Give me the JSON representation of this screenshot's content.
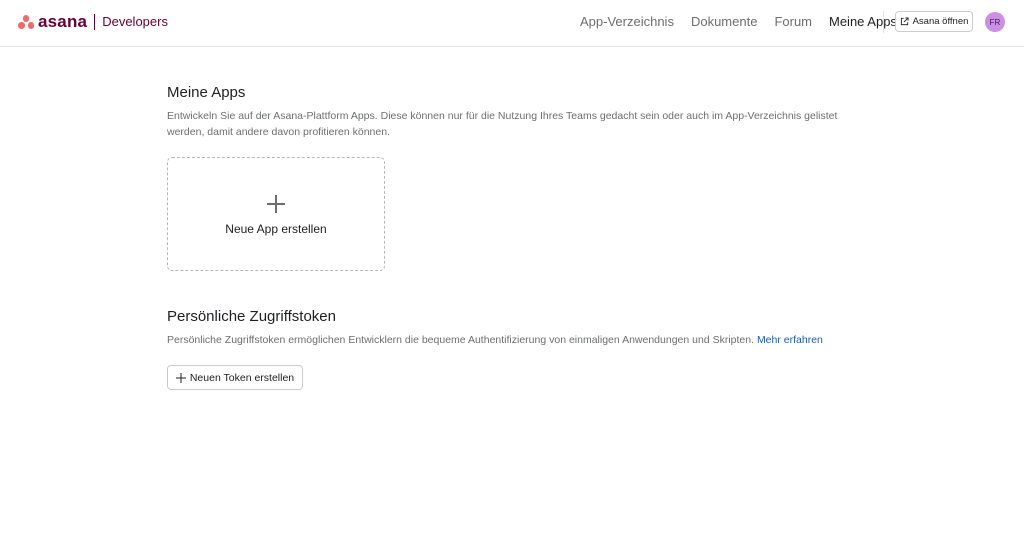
{
  "brand": {
    "logo_word": "asana",
    "subtitle": "Developers",
    "logo_color": "#f06a6a",
    "text_color": "#690031"
  },
  "nav": {
    "items": [
      {
        "label": "App-Verzeichnis",
        "active": false
      },
      {
        "label": "Dokumente",
        "active": false
      },
      {
        "label": "Forum",
        "active": false
      },
      {
        "label": "Meine Apps",
        "active": true
      }
    ]
  },
  "header_actions": {
    "open_asana_label": "Asana öffnen",
    "open_asana_icon": "external-link-icon",
    "avatar_initials": "FR",
    "avatar_color": "#cd8ee6"
  },
  "my_apps": {
    "title": "Meine Apps",
    "description": "Entwickeln Sie auf der Asana-Plattform Apps. Diese können nur für die Nutzung Ihres Teams gedacht sein oder auch im App-Verzeichnis gelistet werden, damit andere davon profitieren können.",
    "new_app_label": "Neue App erstellen",
    "new_app_icon": "plus-icon"
  },
  "tokens": {
    "title": "Persönliche Zugriffstoken",
    "description": "Persönliche Zugriffstoken ermöglichen Entwicklern die bequeme Authentifizierung von einmaligen Anwendungen und Skripten.",
    "learn_more": "Mehr erfahren",
    "link_color": "#1f5bb5",
    "new_token_label": "Neuen Token erstellen",
    "new_token_icon": "plus-icon"
  }
}
